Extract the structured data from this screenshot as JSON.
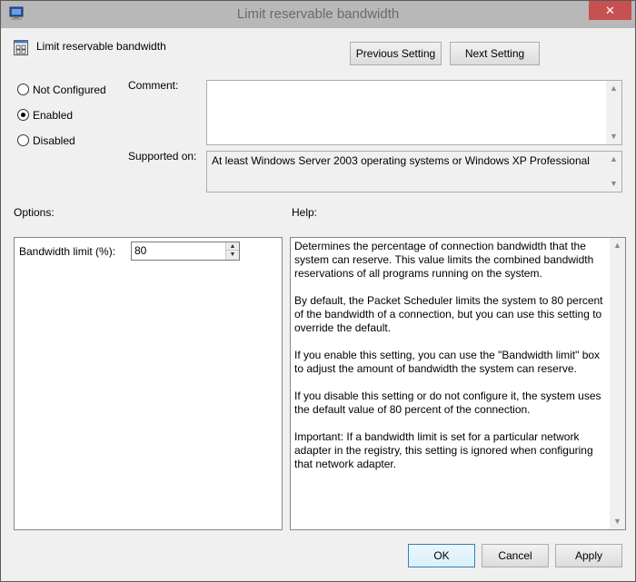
{
  "window": {
    "title": "Limit reservable bandwidth",
    "close_glyph": "✕"
  },
  "header": {
    "title": "Limit reservable bandwidth",
    "icon": "policy-setting-icon",
    "previous_label": "Previous Setting",
    "next_label": "Next Setting"
  },
  "state": {
    "options": [
      {
        "label": "Not Configured",
        "selected": false
      },
      {
        "label": "Enabled",
        "selected": true
      },
      {
        "label": "Disabled",
        "selected": false
      }
    ]
  },
  "comment": {
    "label": "Comment:",
    "value": ""
  },
  "supported": {
    "label": "Supported on:",
    "value": "At least Windows Server 2003 operating systems or Windows XP Professional"
  },
  "options_panel": {
    "heading": "Options:",
    "bandwidth_label": "Bandwidth limit (%):",
    "bandwidth_value": "80"
  },
  "help_panel": {
    "heading": "Help:",
    "paragraphs": [
      "Determines the percentage of connection bandwidth that the system can reserve. This value limits the combined bandwidth reservations of all programs running on the system.",
      "By default, the Packet Scheduler limits the system to 80 percent of the bandwidth of a connection, but you can use this setting to override the default.",
      "If you enable this setting, you can use the \"Bandwidth limit\" box to adjust the amount of bandwidth the system can reserve.",
      "If you disable this setting or do not configure it, the system uses the default value of 80 percent of the connection.",
      "Important: If a bandwidth limit is set for a particular network adapter in the registry, this setting is ignored when configuring that network adapter."
    ]
  },
  "footer": {
    "ok_label": "OK",
    "cancel_label": "Cancel",
    "apply_label": "Apply"
  },
  "colors": {
    "close_button": "#c75050",
    "dialog_background": "#f0f0f0",
    "default_button_border": "#3c7fb1"
  }
}
